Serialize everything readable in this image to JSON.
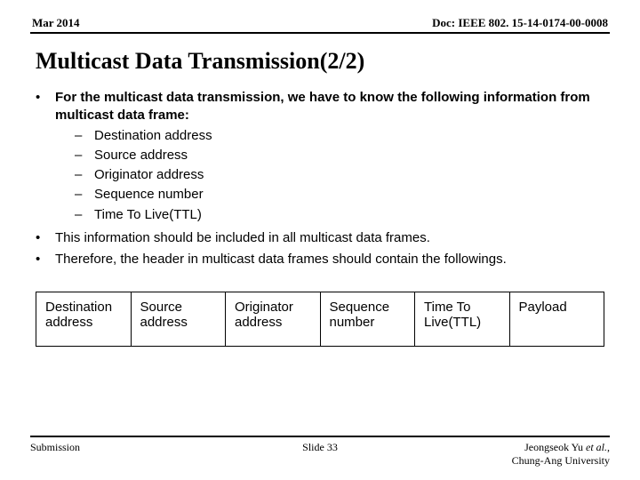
{
  "header": {
    "date": "Mar 2014",
    "docref": "Doc: IEEE 802. 15-14-0174-00-0008"
  },
  "title": "Multicast Data Transmission(2/2)",
  "bullets": {
    "b1_intro": "For the multicast data transmission, we have to know the following information from multicast data frame:",
    "b1_sub": {
      "s1": "Destination address",
      "s2": "Source address",
      "s3": "Originator address",
      "s4": "Sequence number",
      "s5": "Time To Live(TTL)"
    },
    "b2": "This information should be included in all multicast data frames.",
    "b3": "Therefore, the header in multicast data frames should contain the followings."
  },
  "frame_fields": {
    "f1": "Destination address",
    "f2": "Source address",
    "f3": "Originator address",
    "f4": "Sequence number",
    "f5": "Time To Live(TTL)",
    "f6": "Payload"
  },
  "footer": {
    "left": "Submission",
    "center": "Slide 33",
    "author": "Jeongseok Yu",
    "etal": " et al.",
    "affil": "Chung-Ang University"
  }
}
